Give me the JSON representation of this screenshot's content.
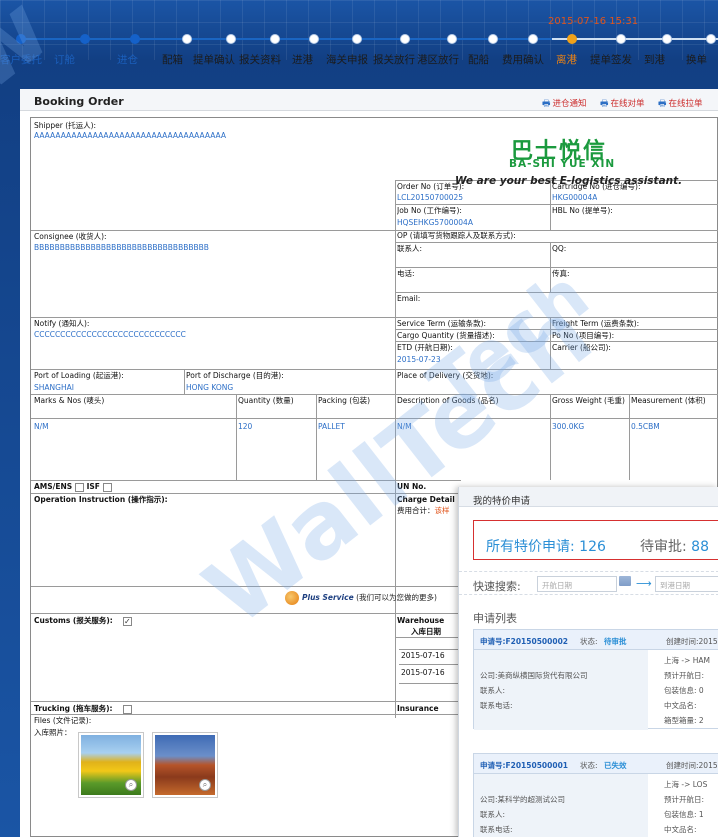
{
  "timestamp": "2015-07-16 15:31",
  "steps": [
    {
      "label": "客户委托",
      "state": "done"
    },
    {
      "label": "订舱",
      "state": "done"
    },
    {
      "label": "进仓",
      "state": "done"
    },
    {
      "label": "配箱",
      "state": "todo"
    },
    {
      "label": "提单确认",
      "state": "todo"
    },
    {
      "label": "报关资料",
      "state": "todo"
    },
    {
      "label": "进港",
      "state": "todo"
    },
    {
      "label": "海关申报",
      "state": "todo"
    },
    {
      "label": "报关放行",
      "state": "todo"
    },
    {
      "label": "港区放行",
      "state": "todo"
    },
    {
      "label": "配船",
      "state": "todo"
    },
    {
      "label": "费用确认",
      "state": "todo"
    },
    {
      "label": "离港",
      "state": "current"
    },
    {
      "label": "提单签发",
      "state": "todo"
    },
    {
      "label": "到港",
      "state": "todo"
    },
    {
      "label": "换单",
      "state": "todo"
    }
  ],
  "panel": {
    "title": "Booking Order",
    "links": [
      "进仓通知",
      "在线对单",
      "在线拉单"
    ]
  },
  "form": {
    "shipper_label": "Shipper (托运人):",
    "shipper_value": "AAAAAAAAAAAAAAAAAAAAAAAAAAAAAAAAAAAA",
    "logo_cn": "巴士悦信",
    "logo_en": "BA-SHI YUE XIN",
    "slogan": "We are your best E-logistics assistant.",
    "order_no_label": "Order No (订单号):",
    "order_no_value": "LCL20150700025",
    "cartridge_no_label": "Cartridge No (进仓编号):",
    "cartridge_no_value": "HKG00004A",
    "job_no_label": "Job No (工作编号):",
    "job_no_value": "HQSEHKG5700004A",
    "hbl_no_label": "HBL No (提单号):",
    "consignee_label": "Consignee (收货人):",
    "consignee_value": "BBBBBBBBBBBBBBBBBBBBBBBBBBBBBBBBBB",
    "op_label": "OP (请填写货物跟踪人及联系方式):",
    "contact_label": "联系人:",
    "qq_label": "QQ:",
    "tel_label": "电话:",
    "fax_label": "传真:",
    "email_label": "Email:",
    "notify_label": "Notify (通知人):",
    "notify_value": "CCCCCCCCCCCCCCCCCCCCCCCCCCCCC",
    "service_term_label": "Service Term (运输条款):",
    "freight_term_label": "Freight Term (运费条款):",
    "cargo_qty_label": "Cargo Quantity (货量描述):",
    "po_no_label": "Po No (项目编号):",
    "etd_label": "ETD (开航日期):",
    "etd_value": "2015-07-23",
    "carrier_label": "Carrier (船公司):",
    "pol_label": "Port of Loading (起运港):",
    "pol_value": "SHANGHAI",
    "pod_label": "Port of Discharge (目的港):",
    "pod_value": "HONG KONG",
    "place_delivery_label": "Place of Delivery (交货地):",
    "marks_label": "Marks & Nos (唛头)",
    "quantity_label": "Quantity (数量)",
    "packing_label": "Packing (包装)",
    "description_label": "Description of Goods (品名)",
    "gross_weight_label": "Gross Weight (毛重)",
    "measurement_label": "Measurement (体积)",
    "marks_value": "N/M",
    "quantity_value": "120",
    "packing_value": "PALLET",
    "description_value": "N/M",
    "gross_weight_value": "300.0KG",
    "measurement_value": "0.5CBM",
    "ams_label": "AMS/ENS",
    "isf_label": "ISF",
    "un_no_label": "UN No.",
    "operation_label": "Operation Instruction (操作指示):",
    "charge_label": "Charge Detail (",
    "charge_total_label": "费用合计：",
    "charge_total_link": "该样",
    "plus_service_brand": "Plus Service",
    "plus_service_text": "(我们可以为您做的更多)",
    "customs_label": "Customs (报关服务):",
    "warehouse_label": "Warehouse",
    "warehouse_col": "入库日期",
    "warehouse_dates": [
      "2015-07-16",
      "2015-07-16"
    ],
    "trucking_label": "Trucking (拖车服务):",
    "insurance_label": "Insurance",
    "files_label": "Files (文件记录):",
    "photos_label": "入库照片："
  },
  "popup": {
    "title": "我的特价申请",
    "all_label": "所有特价申请:",
    "all_count": "126",
    "pending_label": "待审批:",
    "pending_count": "88",
    "search_label": "快速搜索:",
    "start_placeholder": "开航日期",
    "end_placeholder": "到港日期",
    "list_title": "申请列表",
    "cards": [
      {
        "no": "申请号:F20150500002",
        "status_label": "状态:",
        "status": "待审批",
        "status_color": "#2b8fd6",
        "created": "创建时间:2015",
        "company": "公司:美商纵横国际货代有限公司",
        "contact": "联系人:",
        "phone": "联系电话:",
        "right": [
          "上海 -> HAM",
          "预计开航日:",
          "包装信息: 0",
          "中文品名:",
          "箱型箱量: 2"
        ]
      },
      {
        "no": "申请号:F20150500001",
        "status_label": "状态:",
        "status": "已失效",
        "status_color": "#2b8fd6",
        "created": "创建时间:2015",
        "company": "公司:某科学的超测试公司",
        "contact": "联系人:",
        "phone": "联系电话:",
        "right": [
          "上海 -> LOS",
          "预计开航日:",
          "包装信息: 1",
          "中文品名:"
        ]
      }
    ]
  },
  "colors": {
    "background": "#16468e",
    "done": "#1561c9",
    "current": "#f0a21a",
    "link": "#2d6fc7",
    "logo": "#1b9a3e",
    "highlight_border": "#d63030"
  }
}
